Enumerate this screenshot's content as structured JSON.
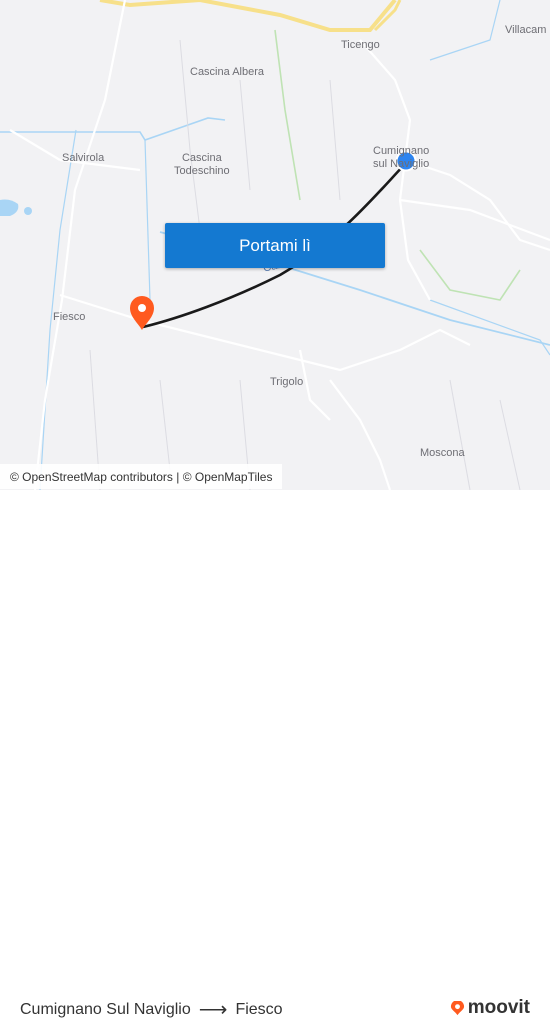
{
  "map": {
    "places": {
      "villacampagna": "Villacam",
      "ticengo": "Ticengo",
      "cascina_albera": "Cascina Albera",
      "cumignano_line1": "Cumignano",
      "cumignano_line2": "sul Naviglio",
      "salvirola": "Salvirola",
      "cascina_todeschino_line1": "Cascina",
      "cascina_todeschino_line2": "Todeschino",
      "canale": "Canale Vacchelli",
      "fiesco": "Fiesco",
      "trigolo": "Trigolo",
      "moscona": "Moscona"
    },
    "cta_label": "Portami lì",
    "attribution": "© OpenStreetMap contributors | © OpenMapTiles",
    "colors": {
      "route": "#1a1a1a",
      "origin_marker": "#2d84f0",
      "destination_marker": "#ff5a1f",
      "water": "#a9d5f5",
      "road_major": "#f7e08a",
      "cta_bg": "#1479d1"
    }
  },
  "footer": {
    "origin": "Cumignano Sul Naviglio",
    "destination": "Fiesco",
    "brand": "moovit"
  }
}
